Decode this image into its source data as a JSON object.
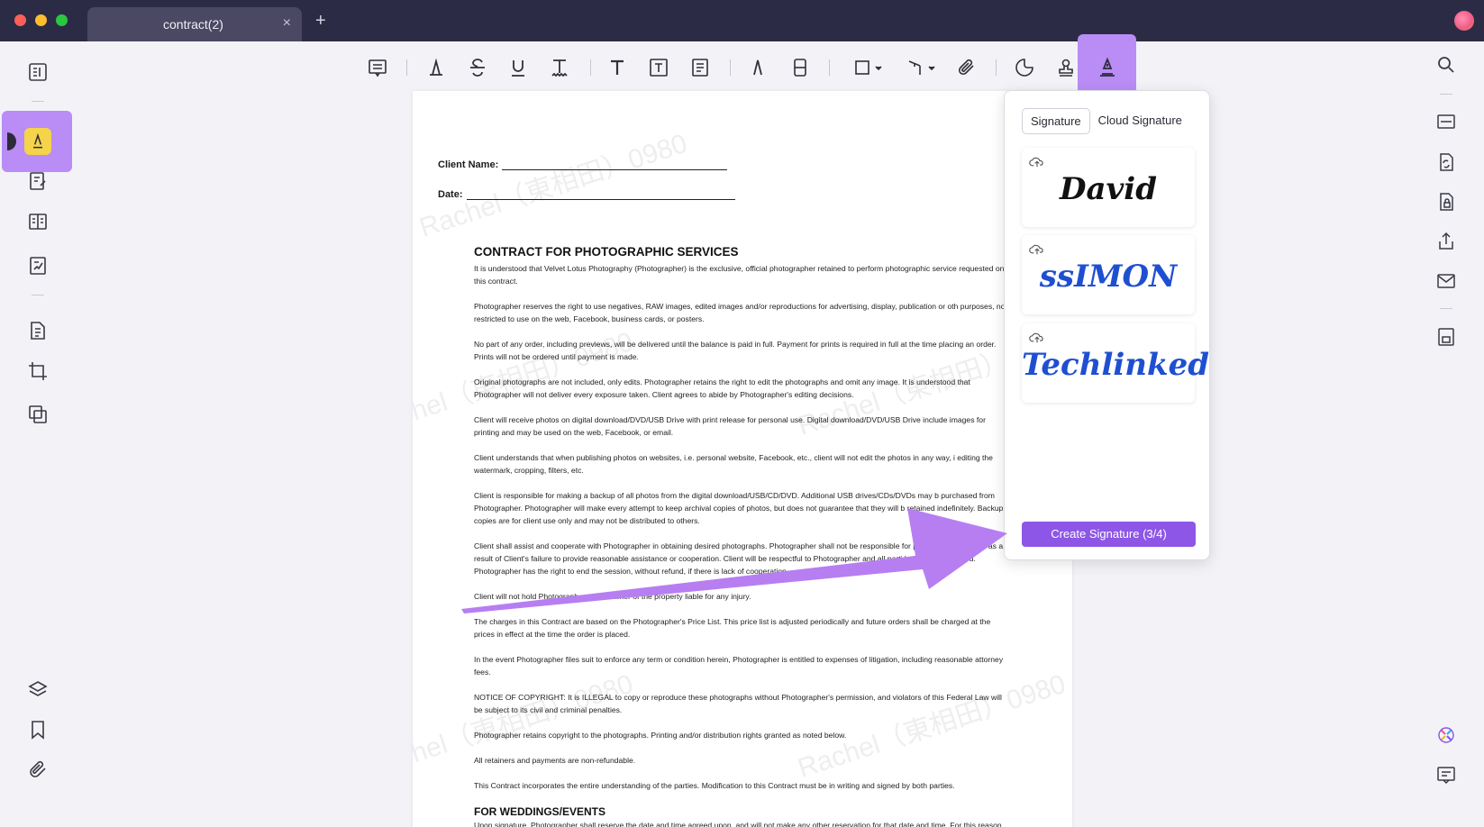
{
  "window": {
    "tab_title": "contract(2)",
    "tab_close": "×",
    "tab_add": "+"
  },
  "document": {
    "client_name_label": "Client Name:",
    "date_label": "Date:",
    "title": "CONTRACT FOR PHOTOGRAPHIC SERVICES",
    "paragraphs": [
      "It is understood that Velvet Lotus Photography (Photographer) is the exclusive, official photographer retained to perform photographic service requested on this contract.",
      "Photographer reserves the right to use negatives, RAW images, edited images and/or reproductions for advertising, display, publication or oth purposes, not restricted to use on the web, Facebook, business cards, or posters.",
      "No part of any order, including previews, will be delivered until the balance is paid in full. Payment for prints is required in full at the time placing an order. Prints will not be ordered until payment is made.",
      "Original photographs are not included, only edits. Photographer retains the right to edit the photographs and omit any image. It is understood that Photographer will not deliver every exposure taken. Client agrees to abide by Photographer's editing decisions.",
      "Client will receive photos on digital download/DVD/USB Drive with print release for personal use. Digital download/DVD/USB Drive include images for printing and may be used on the web, Facebook, or email.",
      "Client understands that when publishing photos on websites, i.e. personal website, Facebook, etc., client will not edit the photos in any way, i editing the watermark, cropping, filters, etc.",
      "Client is responsible for making a backup of all photos from the digital download/USB/CD/DVD. Additional USB drives/CDs/DVDs may b purchased from Photographer. Photographer will make every attempt to keep archival copies of photos, but does not guarantee that they will b retained indefinitely. Backup copies are for client use only and may not be distributed to others.",
      "Client shall assist and cooperate with Photographer in obtaining desired photographs. Photographer shall not be responsible for photograph not taken as a result of Client's failure to provide reasonable assistance or cooperation. Client will be respectful to Photographer and all parti being photographed. Photographer has the right to end the session, without refund, if there is lack of cooperation.",
      "Client will not hold Photographer or the owner of the property liable for any injury.",
      "The charges in this Contract are based on the Photographer's Price List. This price list is adjusted periodically and future orders shall be charged at the prices in effect at the time the order is placed.",
      "In the event Photographer files suit to enforce any term or condition herein, Photographer is entitled to expenses of litigation, including reasonable attorney fees.",
      "NOTICE OF COPYRIGHT: It is ILLEGAL to copy or reproduce these photographs without Photographer's permission, and violators of this Federal Law will be subject to its civil and criminal penalties.",
      "Photographer retains copyright to the photographs. Printing and/or distribution rights granted as noted below.",
      "All retainers and payments are non-refundable.",
      "This Contract incorporates the entire understanding of the parties. Modification to this Contract must be in writing and signed by both parties."
    ],
    "section_title": "FOR WEDDINGS/EVENTS",
    "section_paragraph": "Upon signature, Photographer shall reserve the date and time agreed upon, and will not make any other reservation for that date and time. For this reason, all retainers are non-refundable, even if the date of the wedding is changed or wedding is cancelled for any reason.",
    "watermark_text": "Rachel（東相田）0980"
  },
  "signature_panel": {
    "tabs": [
      "Signature",
      "Cloud Signature"
    ],
    "active_tab": "Signature",
    "signatures": [
      "David",
      "ssIMON",
      "Techlinked"
    ],
    "signature_colors": [
      "#111111",
      "#1f4fd1",
      "#1f4fd1"
    ],
    "create_button": "Create Signature (3/4)"
  },
  "colors": {
    "highlight": "#b98cf6",
    "accent": "#8d56e6",
    "arrow": "#b77ef2"
  }
}
